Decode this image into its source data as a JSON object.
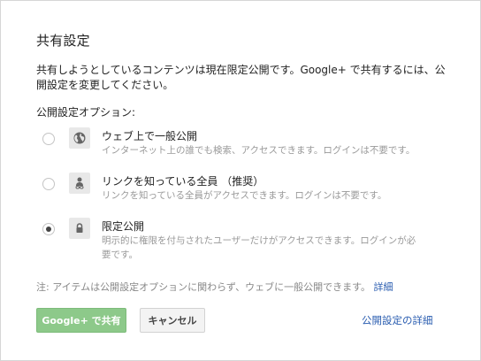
{
  "dialog": {
    "title": "共有設定",
    "description": "共有しようとしているコンテンツは現在限定公開です。Google+ で共有するには、公開設定を変更してください。",
    "options_label": "公開設定オプション:",
    "options": [
      {
        "title": "ウェブ上で一般公開",
        "subtitle": "インターネット上の誰でも検索、アクセスできます。ログインは不要です。",
        "icon": "globe-icon",
        "selected": false
      },
      {
        "title": "リンクを知っている全員 （推奨）",
        "subtitle": "リンクを知っている全員がアクセスできます。ログインは不要です。",
        "icon": "link-person-icon",
        "selected": false
      },
      {
        "title": "限定公開",
        "subtitle": "明示的に権限を付与されたユーザーだけがアクセスできます。ログインが必要です。",
        "icon": "lock-icon",
        "selected": true
      }
    ],
    "note_text": "注: アイテムは公開設定オプションに関わらず、ウェブに一般公開できます。",
    "note_link": "詳細",
    "share_button": "Google+ で共有",
    "cancel_button": "キャンセル",
    "details_link": "公開設定の詳細"
  },
  "colors": {
    "share_button_bg": "#8dc98a",
    "link": "#2a5db0"
  }
}
